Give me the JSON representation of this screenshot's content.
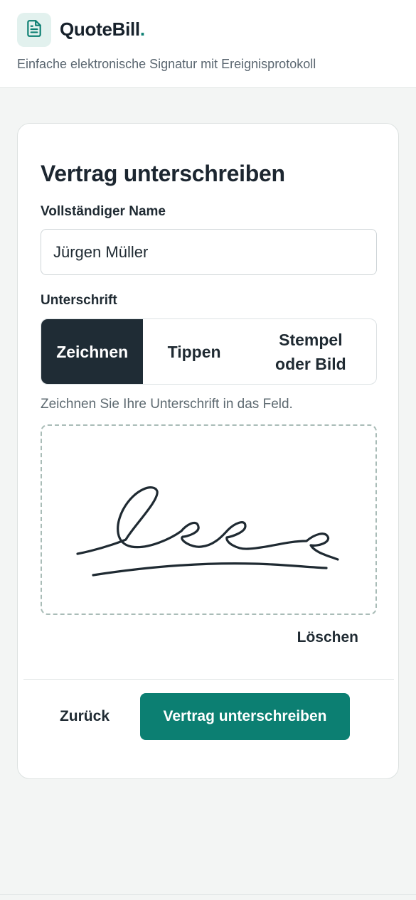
{
  "header": {
    "brand_name": "QuoteBill",
    "brand_dot": ".",
    "tagline": "Einfache elektronische Signatur mit Ereignisprotokoll",
    "logo_icon": "document-icon"
  },
  "form": {
    "title": "Vertrag unterschreiben",
    "name_label": "Vollständiger Name",
    "name_value": "Jürgen Müller",
    "signature_label": "Unterschrift",
    "tabs": [
      {
        "label": "Zeichnen",
        "active": true
      },
      {
        "label": "Tippen",
        "active": false
      },
      {
        "label": "Stempel\noder Bild",
        "active": false
      }
    ],
    "hint": "Zeichnen Sie Ihre Unterschrift in das Feld.",
    "clear_label": "Löschen",
    "back_label": "Zurück",
    "submit_label": "Vertrag unterschreiben"
  },
  "colors": {
    "accent": "#0c7f72",
    "active_tab": "#1f2c35",
    "background": "#f3f5f4"
  }
}
